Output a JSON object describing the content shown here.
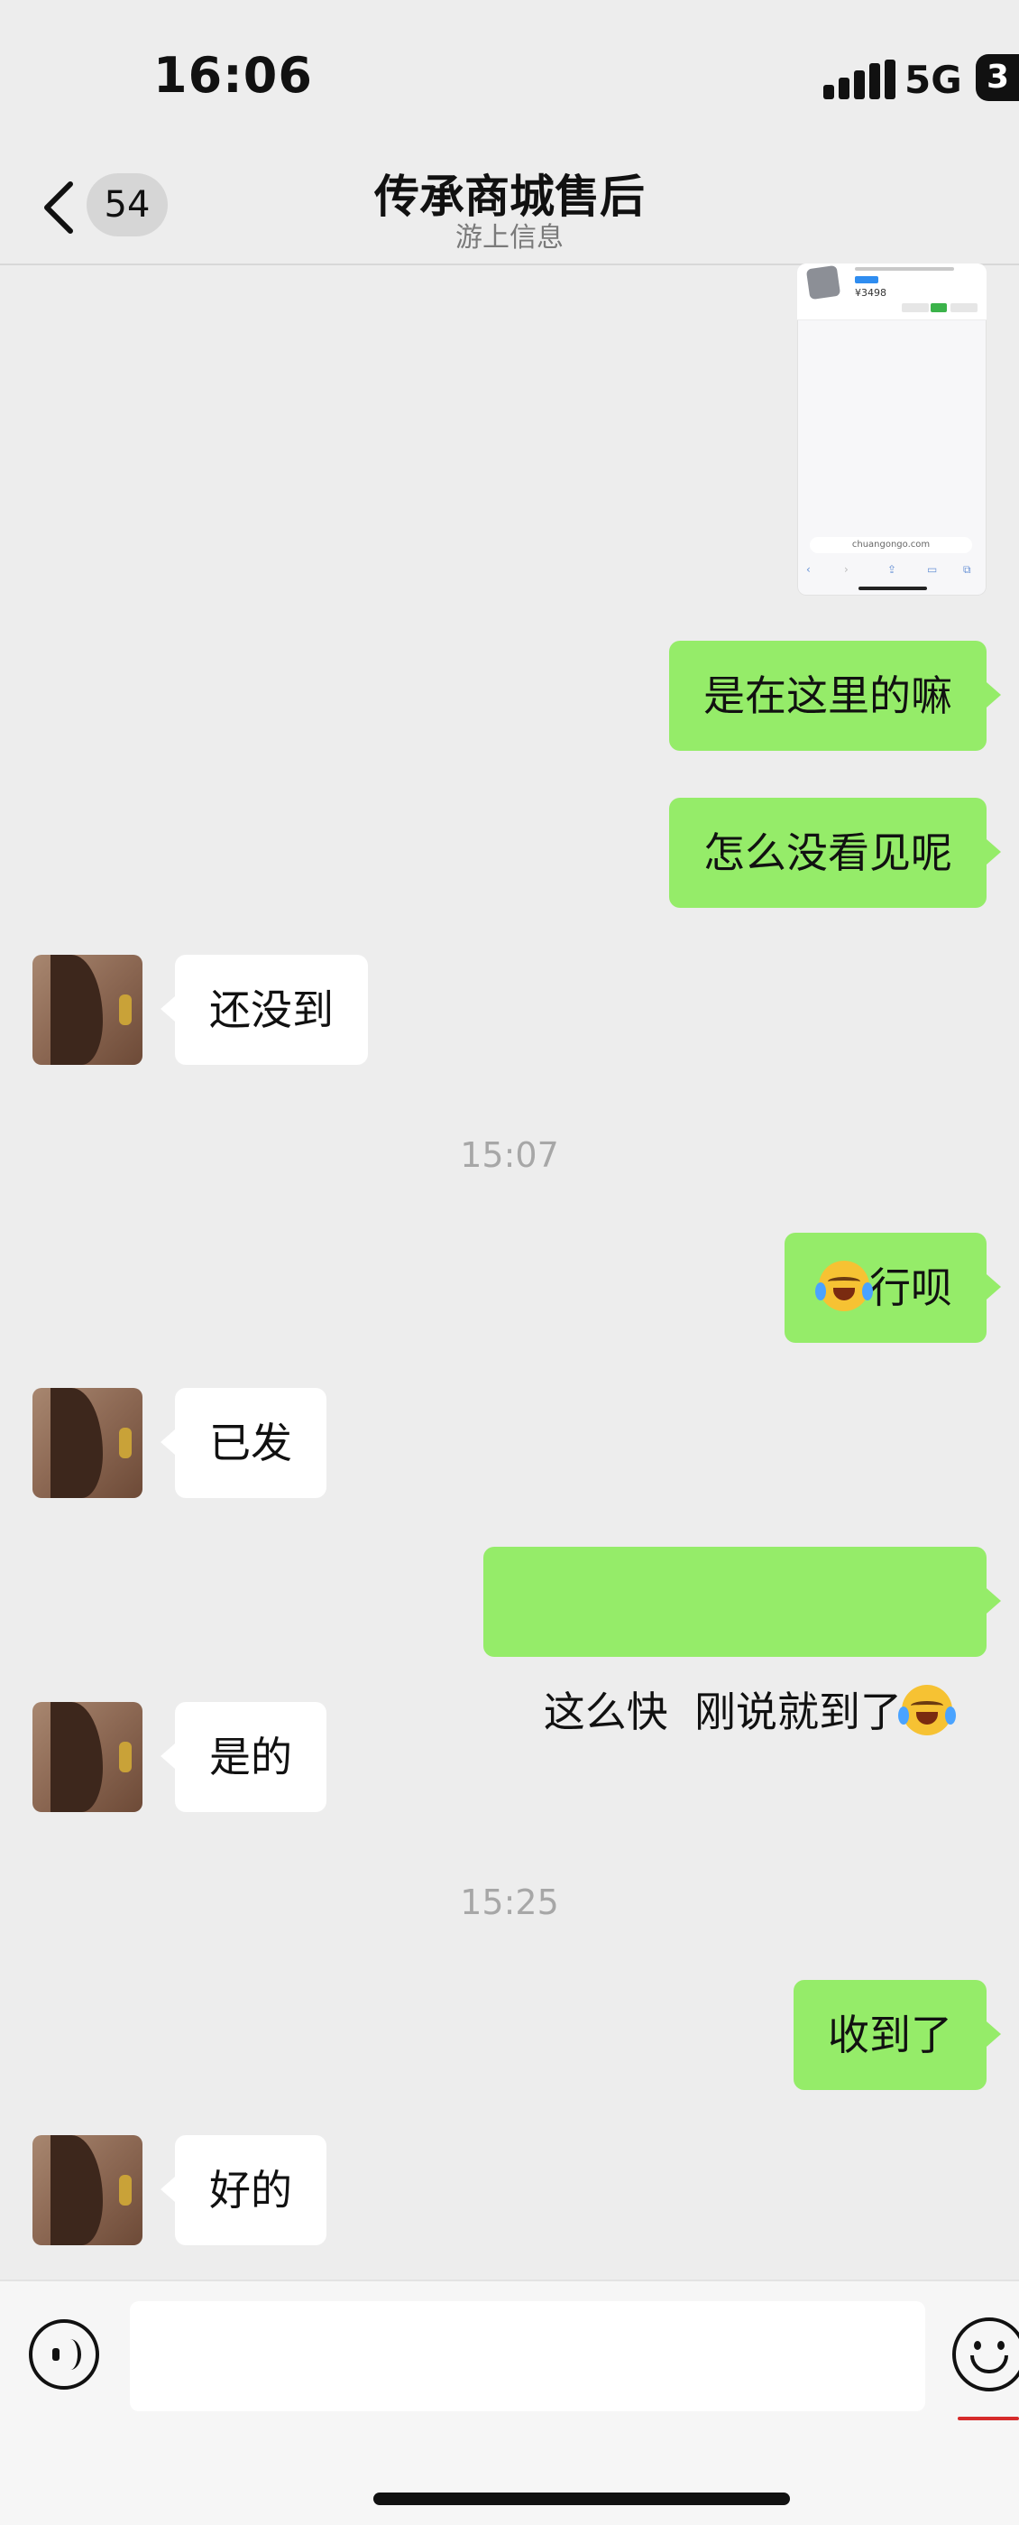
{
  "status_bar": {
    "time": "16:06",
    "network": "5G",
    "battery": "3"
  },
  "header": {
    "unread_count": "54",
    "title": "传承商城售后",
    "subtitle": "游上信息"
  },
  "screenshot_preview": {
    "price": "¥3498",
    "url": "chuangongo.com"
  },
  "messages": [
    {
      "from": "me",
      "text": "是在这里的嘛"
    },
    {
      "from": "me",
      "text": "怎么没看见呢"
    },
    {
      "from": "them",
      "text": "还没到"
    },
    {
      "type": "time",
      "text": "15:07"
    },
    {
      "from": "me",
      "text": "行呗",
      "emoji": "face-with-tears-of-joy"
    },
    {
      "from": "them",
      "text": "已发"
    },
    {
      "from": "me",
      "text": "这么快  刚说就到了",
      "emoji": "face-with-tears-of-joy"
    },
    {
      "from": "them",
      "text": "是的"
    },
    {
      "type": "time",
      "text": "15:25"
    },
    {
      "from": "me",
      "text": "收到了"
    },
    {
      "from": "them",
      "text": "好的"
    }
  ],
  "input": {
    "value": "",
    "placeholder": ""
  },
  "colors": {
    "outgoing_bubble": "#95ec69",
    "incoming_bubble": "#ffffff",
    "background": "#ededed"
  }
}
